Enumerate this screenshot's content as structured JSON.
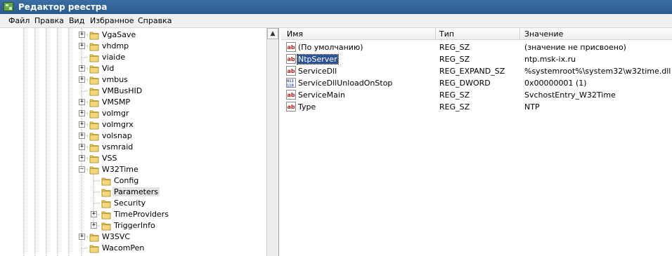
{
  "window": {
    "title": "Редактор реестра"
  },
  "menu": [
    "Файл",
    "Правка",
    "Вид",
    "Избранное",
    "Справка"
  ],
  "tree": {
    "nodes": [
      {
        "label": "VgaSave",
        "level": 0,
        "expander": "+"
      },
      {
        "label": "vhdmp",
        "level": 0,
        "expander": "+"
      },
      {
        "label": "viaide",
        "level": 0,
        "expander": ""
      },
      {
        "label": "Vid",
        "level": 0,
        "expander": "+"
      },
      {
        "label": "vmbus",
        "level": 0,
        "expander": "+"
      },
      {
        "label": "VMBusHID",
        "level": 0,
        "expander": ""
      },
      {
        "label": "VMSMP",
        "level": 0,
        "expander": "+"
      },
      {
        "label": "volmgr",
        "level": 0,
        "expander": "+"
      },
      {
        "label": "volmgrx",
        "level": 0,
        "expander": "+"
      },
      {
        "label": "volsnap",
        "level": 0,
        "expander": "+"
      },
      {
        "label": "vsmraid",
        "level": 0,
        "expander": "+"
      },
      {
        "label": "VSS",
        "level": 0,
        "expander": "+"
      },
      {
        "label": "W32Time",
        "level": 0,
        "expander": "−"
      },
      {
        "label": "Config",
        "level": 1,
        "expander": ""
      },
      {
        "label": "Parameters",
        "level": 1,
        "expander": "",
        "selected": true
      },
      {
        "label": "Security",
        "level": 1,
        "expander": ""
      },
      {
        "label": "TimeProviders",
        "level": 1,
        "expander": "+"
      },
      {
        "label": "TriggerInfo",
        "level": 1,
        "expander": "+"
      },
      {
        "label": "W3SVC",
        "level": 0,
        "expander": "+"
      },
      {
        "label": "WacomPen",
        "level": 0,
        "expander": ""
      }
    ]
  },
  "list": {
    "columns": [
      "Имя",
      "Тип",
      "Значение"
    ],
    "rows": [
      {
        "icon": "string-value-icon",
        "name": "(По умолчанию)",
        "type": "REG_SZ",
        "data": "(значение не присвоено)"
      },
      {
        "icon": "string-value-icon",
        "name": "NtpServer",
        "type": "REG_SZ",
        "data": "ntp.msk-ix.ru",
        "focused": true
      },
      {
        "icon": "string-value-icon",
        "name": "ServiceDll",
        "type": "REG_EXPAND_SZ",
        "data": "%systemroot%\\system32\\w32time.dll"
      },
      {
        "icon": "dword-value-icon",
        "name": "ServiceDllUnloadOnStop",
        "type": "REG_DWORD",
        "data": "0x00000001 (1)"
      },
      {
        "icon": "string-value-icon",
        "name": "ServiceMain",
        "type": "REG_SZ",
        "data": "SvchostEntry_W32Time"
      },
      {
        "icon": "string-value-icon",
        "name": "Type",
        "type": "REG_SZ",
        "data": "NTP"
      }
    ]
  },
  "colors": {
    "titlebar": "#2b5a8c",
    "selection": "#2f5496",
    "folder": "#e8c35a"
  }
}
